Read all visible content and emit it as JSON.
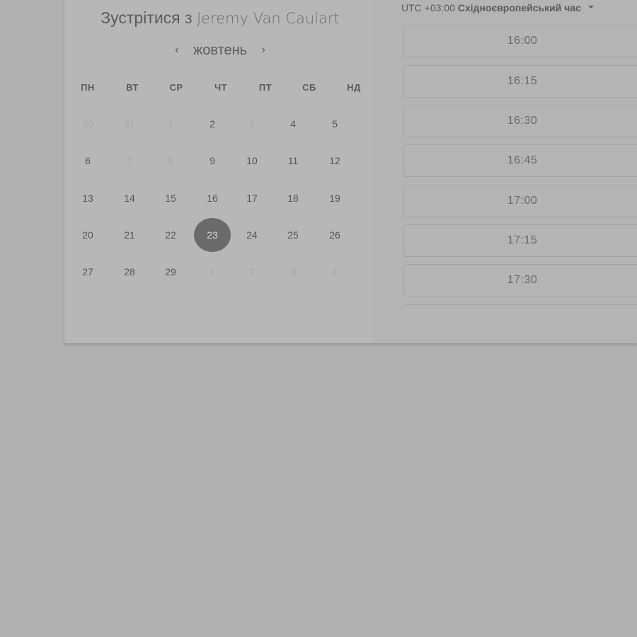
{
  "title": {
    "prefix": "Зустрітися з",
    "host": "Jeremy Van Caulart"
  },
  "calendar": {
    "month": "жовтень",
    "prev_icon": "chevron-left-icon",
    "next_icon": "chevron-right-icon",
    "weekdays": [
      "ПН",
      "ВТ",
      "СР",
      "ЧТ",
      "ПТ",
      "СБ",
      "НД"
    ],
    "weeks": [
      [
        {
          "label": "30",
          "available": false
        },
        {
          "label": "31",
          "available": false
        },
        {
          "label": "1",
          "available": false
        },
        {
          "label": "2",
          "available": true
        },
        {
          "label": "3",
          "available": false
        },
        {
          "label": "4",
          "available": true
        },
        {
          "label": "5",
          "available": true
        }
      ],
      [
        {
          "label": "6",
          "available": true
        },
        {
          "label": "7",
          "available": false
        },
        {
          "label": "8",
          "available": false
        },
        {
          "label": "9",
          "available": true
        },
        {
          "label": "10",
          "available": true
        },
        {
          "label": "11",
          "available": true
        },
        {
          "label": "12",
          "available": true
        }
      ],
      [
        {
          "label": "13",
          "available": true
        },
        {
          "label": "14",
          "available": true
        },
        {
          "label": "15",
          "available": true
        },
        {
          "label": "16",
          "available": true
        },
        {
          "label": "17",
          "available": true
        },
        {
          "label": "18",
          "available": true
        },
        {
          "label": "19",
          "available": true
        }
      ],
      [
        {
          "label": "20",
          "available": true
        },
        {
          "label": "21",
          "available": true
        },
        {
          "label": "22",
          "available": true
        },
        {
          "label": "23",
          "available": true,
          "selected": true
        },
        {
          "label": "24",
          "available": true
        },
        {
          "label": "25",
          "available": true
        },
        {
          "label": "26",
          "available": true
        }
      ],
      [
        {
          "label": "27",
          "available": true
        },
        {
          "label": "28",
          "available": true
        },
        {
          "label": "29",
          "available": true
        },
        {
          "label": "1",
          "available": false
        },
        {
          "label": "2",
          "available": false
        },
        {
          "label": "3",
          "available": false
        },
        {
          "label": "4",
          "available": false
        }
      ]
    ]
  },
  "timezone": {
    "offset": "UTC +03:00",
    "name": "Східноєвропейський час",
    "icon": "caret-down-icon"
  },
  "time_slots": [
    "16:00",
    "16:15",
    "16:30",
    "16:45",
    "17:00",
    "17:15",
    "17:30",
    ""
  ],
  "colors": {
    "overlay_background": "#b0b0b0",
    "selected_day": "#6a6a6a",
    "slot_border": "#a3a3a3"
  }
}
